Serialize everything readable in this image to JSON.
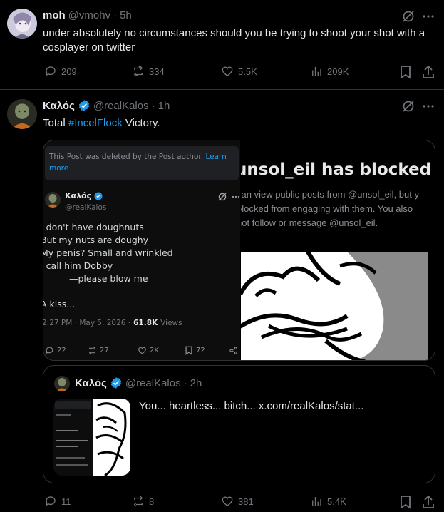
{
  "post1": {
    "name": "moh",
    "handle": "@vmohv",
    "sep": "·",
    "time": "5h",
    "text": "under absolutely no circumstances should you be trying to shoot your shot with a cosplayer on twitter",
    "replies": "209",
    "reposts": "334",
    "likes": "5.5K",
    "views": "209K"
  },
  "post2": {
    "name": "Καλός",
    "handle": "@realKalos",
    "sep": "·",
    "time": "1h",
    "text_prefix": "Total ",
    "hashtag": "#IncelFlock",
    "text_suffix": " Victory.",
    "replies": "11",
    "reposts": "8",
    "likes": "381",
    "views": "5.4K"
  },
  "media_left": {
    "deleted_notice": "This Post was deleted by the Post author.",
    "learn_more": "Learn more",
    "name": "Καλός",
    "handle": "@realKalos",
    "lines": [
      "I don't have doughnuts",
      "But my nuts are doughy",
      "My penis? Small and wrinkled",
      "I call him Dobby",
      "—please blow me",
      "A kiss..."
    ],
    "meta_time": "2:27 PM · May 5, 2026 ·",
    "meta_views": "61.8K",
    "meta_views_label": "Views",
    "replies": "22",
    "reposts": "27",
    "likes": "2K",
    "bookmarks": "72"
  },
  "media_right": {
    "headline": "unsol_eil has blocked yo",
    "body_lines": [
      "can view public posts from @unsol_eil, but y",
      "blocked from engaging with them. You also",
      "not follow or message @unsol_eil."
    ]
  },
  "quote": {
    "name": "Καλός",
    "handle": "@realKalos",
    "sep": "·",
    "time": "2h",
    "text": "You... heartless... bitch...  x.com/realKalos/stat..."
  },
  "colors": {
    "accent": "#1d9bf0",
    "muted": "#71767b",
    "border": "#2f3336",
    "text": "#e7e9ea",
    "verified": "#1d9bf0"
  }
}
